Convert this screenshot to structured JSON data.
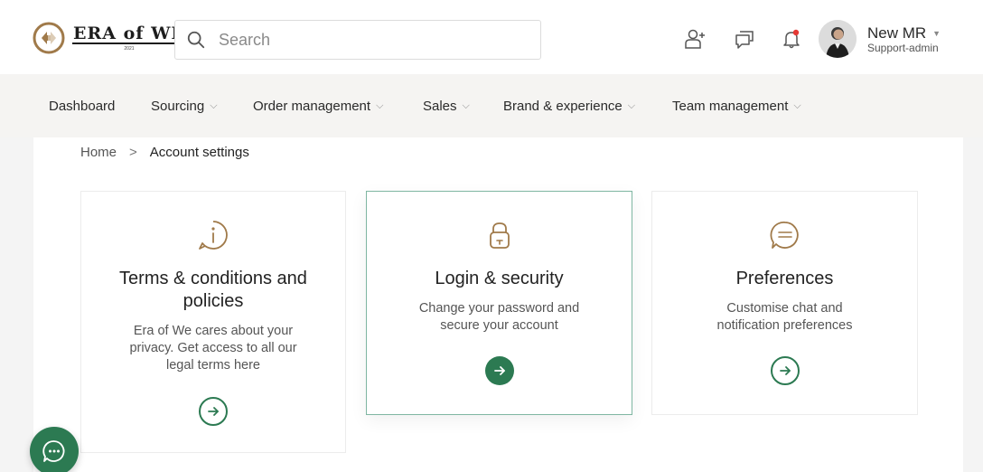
{
  "header": {
    "logo": {
      "text": "ERA of WE",
      "year": "2021"
    },
    "search": {
      "placeholder": "Search",
      "value": ""
    },
    "icons": [
      "add-user-icon",
      "chat-bubbles-icon",
      "notification-bell-icon"
    ],
    "user": {
      "name": "New MR",
      "role": "Support-admin"
    }
  },
  "nav": {
    "items": [
      {
        "label": "Dashboard",
        "has_dropdown": false
      },
      {
        "label": "Sourcing",
        "has_dropdown": true
      },
      {
        "label": "Order management",
        "has_dropdown": true
      },
      {
        "label": "Sales",
        "has_dropdown": true
      },
      {
        "label": "Brand & experience",
        "has_dropdown": true
      },
      {
        "label": "Team management",
        "has_dropdown": true
      }
    ],
    "caret": "⌵"
  },
  "breadcrumb": {
    "home": "Home",
    "separator": ">",
    "current": "Account settings"
  },
  "cards": [
    {
      "icon": "info-circle-icon",
      "title_line1": "Terms & conditions and",
      "title_line2": "policies",
      "desc_line1": "Era of We cares about your",
      "desc_line2": "privacy. Get access to all our",
      "desc_line3": "legal terms here"
    },
    {
      "icon": "lock-icon",
      "title_line1": "Login & security",
      "desc_line1": "Change your password and",
      "desc_line2": "secure your account",
      "active": true
    },
    {
      "icon": "chat-lines-icon",
      "title_line1": "Preferences",
      "desc_line1": "Customise chat and",
      "desc_line2": "notification preferences"
    }
  ],
  "colors": {
    "accent": "#2c7a52",
    "icon_gold": "#a07a4a",
    "active_border": "#7fb6a2",
    "notification_dot": "#e53935"
  }
}
